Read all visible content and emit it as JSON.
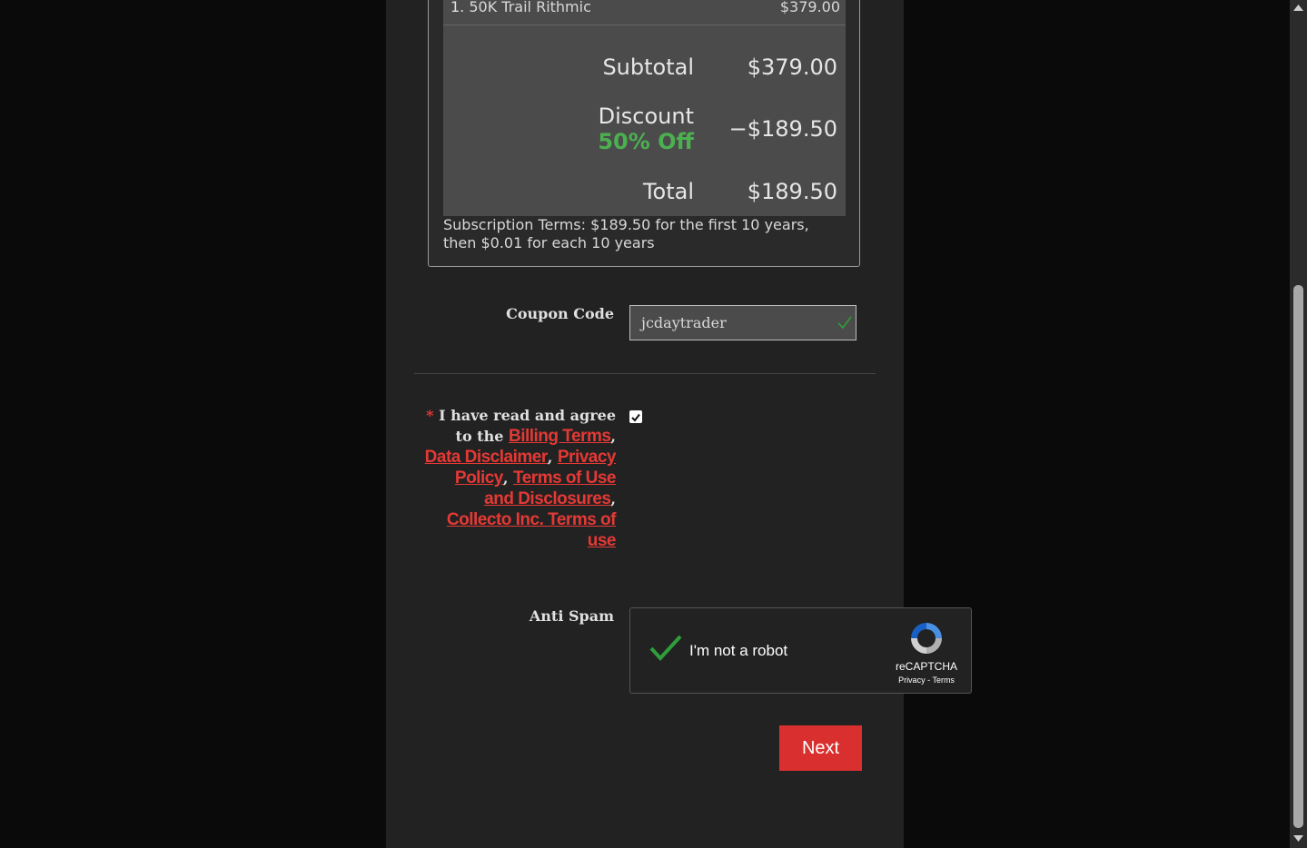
{
  "order": {
    "item_number": "1.",
    "item_name": "50K Trail Rithmic",
    "item_price": "$379.00",
    "subtotal_label": "Subtotal",
    "subtotal_value": "$379.00",
    "discount_label": "Discount",
    "discount_percent": "50% Off",
    "discount_value": "−$189.50",
    "total_label": "Total",
    "total_value": "$189.50",
    "subscription_terms": "Subscription Terms: $189.50 for the first 10 years, then $0.01 for each 10 years"
  },
  "coupon": {
    "label": "Coupon Code",
    "value": "jcdaytrader"
  },
  "agreement": {
    "required_mark": "*",
    "text_prefix": "I have read and agree to the",
    "link_billing": "Billing Terms",
    "link_data": "Data Disclaimer",
    "link_privacy": "Privacy Policy",
    "link_terms_use": "Terms of Use and Disclosures",
    "link_collecto": "Collecto Inc. Terms of use",
    "checked": true
  },
  "antispam": {
    "label": "Anti Spam",
    "captcha_text": "I'm not a robot",
    "captcha_brand": "reCAPTCHA",
    "captcha_privacy": "Privacy",
    "captcha_separator": "-",
    "captcha_terms": "Terms"
  },
  "actions": {
    "next_label": "Next"
  },
  "colors": {
    "accent_red": "#d9302f",
    "discount_green": "#4caf50",
    "check_green": "#2e9d3a"
  }
}
